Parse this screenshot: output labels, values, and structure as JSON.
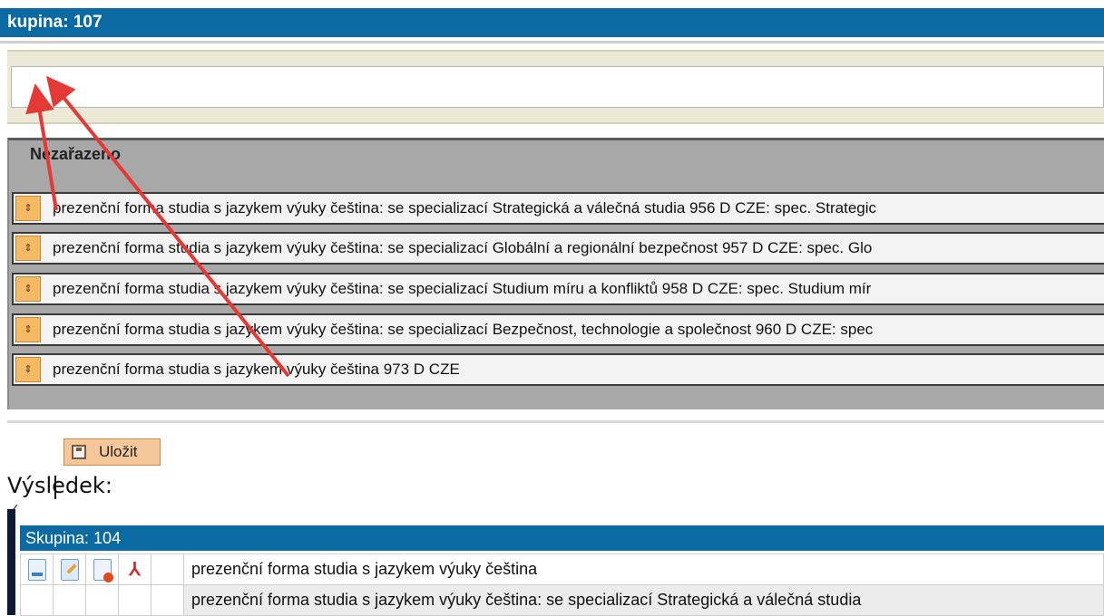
{
  "top_group": {
    "title": "kupina: 107"
  },
  "name_field": {
    "value": ""
  },
  "unassigned": {
    "label": "Nezařazeno",
    "items": [
      "prezenční forma studia s jazykem výuky čeština: se specializací Strategická a válečná studia 956  D CZE: spec. Strategic",
      "prezenční forma studia s jazykem výuky čeština: se specializací Globální a regionální bezpečnost 957  D CZE: spec. Glo",
      "prezenční forma studia s jazykem výuky čeština: se specializací Studium míru a konfliktů 958  D CZE: spec. Studium mír",
      "prezenční forma studia s jazykem výuky čeština: se specializací Bezpečnost, technologie a společnost 960  D CZE: spec",
      "prezenční forma studia s jazykem výuky čeština 973  D CZE"
    ]
  },
  "save_button": {
    "label": "Uložit",
    "icon": "save-icon"
  },
  "result": {
    "label": "Výsledek:",
    "group_title": "Skupina: 104",
    "rows": [
      "prezenční forma studia s jazykem výuky čeština",
      "prezenční forma studia s jazykem výuky čeština: se specializací Strategická a válečná studia"
    ],
    "row_icons": [
      "document-icon",
      "edit-icon",
      "delete-icon",
      "pdf-icon"
    ]
  },
  "colors": {
    "header": "#0a6aa1",
    "handle": "#f6b964",
    "annotation_arrow": "#e53935"
  }
}
